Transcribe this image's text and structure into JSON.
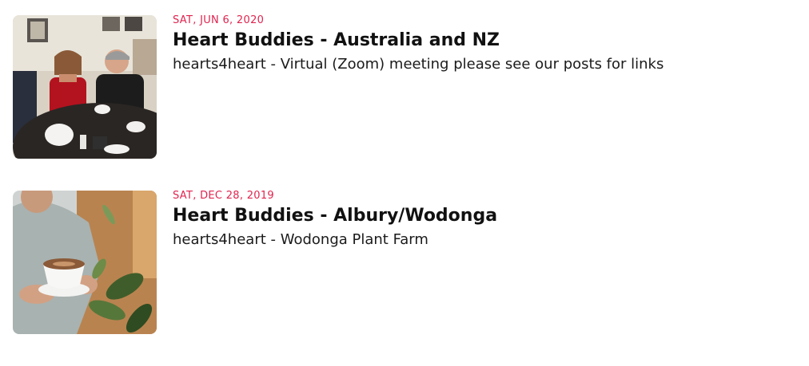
{
  "events": [
    {
      "date": "SAT, JUN 6, 2020",
      "title": "Heart Buddies - Australia and NZ",
      "subtitle": "hearts4heart - Virtual (Zoom) meeting please see our posts for links",
      "image": "group-cafe-photo"
    },
    {
      "date": "SAT, DEC 28, 2019",
      "title": "Heart Buddies - Albury/Wodonga",
      "subtitle": "hearts4heart - Wodonga Plant Farm",
      "image": "coffee-cup-photo"
    }
  ]
}
